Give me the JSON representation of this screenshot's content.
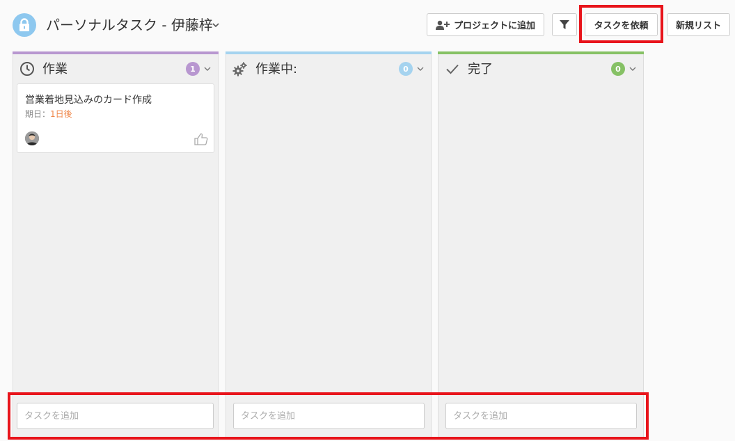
{
  "header": {
    "title": "パーソナルタスク - 伊藤梓",
    "buttons": {
      "add_to_project": "プロジェクトに追加",
      "request_task": "タスクを依頼",
      "new_list": "新規リスト"
    }
  },
  "colors": {
    "lock_circle": "#8ec8ef",
    "highlight": "#e8141b",
    "due_value": "#ef8547"
  },
  "columns": [
    {
      "title": "作業",
      "count": "1",
      "icon": "clock-icon",
      "accent": "#b897d0",
      "tasks": [
        {
          "title": "営業着地見込みのカード作成",
          "due_label": "期日：",
          "due_value": "1日後"
        }
      ],
      "add_placeholder": "タスクを追加"
    },
    {
      "title": "作業中:",
      "count": "0",
      "icon": "gears-icon",
      "accent": "#a5d3ef",
      "tasks": [],
      "add_placeholder": "タスクを追加"
    },
    {
      "title": "完了",
      "count": "0",
      "icon": "check-icon",
      "accent": "#86c165",
      "tasks": [],
      "add_placeholder": "タスクを追加"
    }
  ]
}
